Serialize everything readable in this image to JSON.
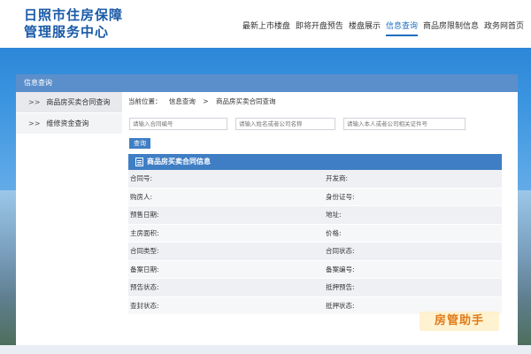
{
  "header": {
    "logo_line1": "日照市住房保障",
    "logo_line2": "管理服务中心",
    "nav": [
      {
        "label": "最新上市楼盘"
      },
      {
        "label": "即将开盘预告"
      },
      {
        "label": "楼盘展示"
      },
      {
        "label": "信息查询"
      },
      {
        "label": "商品房限制信息"
      },
      {
        "label": "政务网首页"
      }
    ],
    "active_nav": "信息查询"
  },
  "panel": {
    "title": "信息查询",
    "sidebar": [
      {
        "label": "商品房买卖合同查询"
      },
      {
        "label": "维修资金查询"
      }
    ],
    "breadcrumb": {
      "prefix": "当前位置：",
      "part1": "信息查询",
      "sep": ">",
      "part2": "商品房买卖合同查询"
    },
    "search": {
      "contract_placeholder": "请输入合同编号",
      "name_placeholder": "请输入姓名或者公司名称",
      "id_placeholder": "请输入本人或者公司相关证件号",
      "button": "查询"
    },
    "table": {
      "title": "商品房买卖合同信息",
      "rows": [
        {
          "left": "合同号:",
          "right": "开发商:"
        },
        {
          "left": "购房人:",
          "right": "身份证号:"
        },
        {
          "left": "预售日期:",
          "right": "地址:"
        },
        {
          "left": "主房面积:",
          "right": "价格:"
        },
        {
          "left": "合同类型:",
          "right": "合同状态:"
        },
        {
          "left": "备案日期:",
          "right": "备案编号:"
        },
        {
          "left": "预告状态:",
          "right": "抵押预告:"
        },
        {
          "left": "查封状态:",
          "right": "抵押状态:"
        }
      ]
    }
  },
  "watermark": "房管助手",
  "colors": {
    "brand": "#1a5aa8",
    "accent": "#3f7ec4",
    "panel_header": "#5b8fcb"
  }
}
